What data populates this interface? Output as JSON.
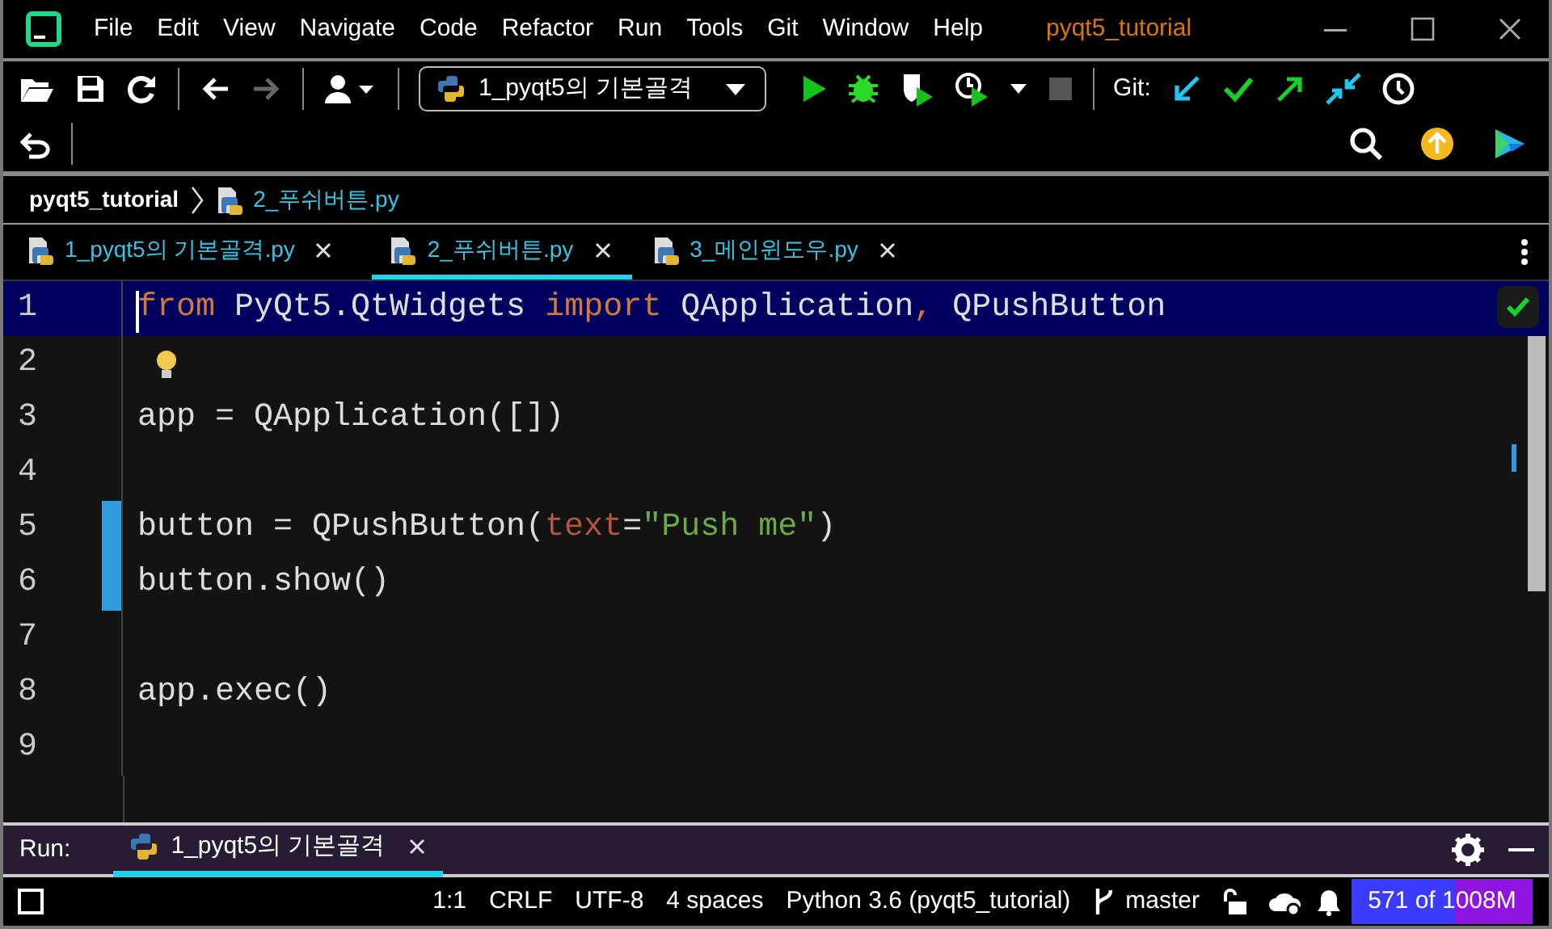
{
  "window": {
    "title": "pyqt5_tutorial"
  },
  "menu": [
    "File",
    "Edit",
    "View",
    "Navigate",
    "Code",
    "Refactor",
    "Run",
    "Tools",
    "Git",
    "Window",
    "Help"
  ],
  "toolbar": {
    "run_config": "1_pyqt5의 기본골격",
    "git_label": "Git:"
  },
  "breadcrumb": [
    "pyqt5_tutorial",
    "2_푸쉬버튼.py"
  ],
  "tabs": [
    {
      "label": "1_pyqt5의 기본골격.py",
      "selected": false
    },
    {
      "label": "2_푸쉬버튼.py",
      "selected": true
    },
    {
      "label": "3_메인윈도우.py",
      "selected": false
    }
  ],
  "editor": {
    "lines": [
      {
        "number": "1",
        "current": true,
        "changed": false,
        "bulb": false,
        "tokens": [
          {
            "kind": "keyword",
            "text": "from"
          },
          {
            "kind": "plain",
            "text": " PyQt5.QtWidgets "
          },
          {
            "kind": "keyword",
            "text": "import"
          },
          {
            "kind": "plain",
            "text": " QApplication"
          },
          {
            "kind": "keyword",
            "text": ","
          },
          {
            "kind": "plain",
            "text": " QPushButton"
          }
        ]
      },
      {
        "number": "2",
        "current": false,
        "changed": false,
        "bulb": true
      },
      {
        "number": "3",
        "current": false,
        "changed": false,
        "bulb": false,
        "tokens": [
          {
            "kind": "plain",
            "text": "app = QApplication([])"
          }
        ]
      },
      {
        "number": "4",
        "current": false,
        "changed": false,
        "bulb": false
      },
      {
        "number": "5",
        "current": false,
        "changed": true,
        "bulb": false,
        "tokens": [
          {
            "kind": "plain",
            "text": "button = QPushButton("
          },
          {
            "kind": "param",
            "text": "text"
          },
          {
            "kind": "plain",
            "text": "="
          },
          {
            "kind": "string",
            "text": "\"Push me\""
          },
          {
            "kind": "plain",
            "text": ")"
          }
        ]
      },
      {
        "number": "6",
        "current": false,
        "changed": true,
        "bulb": false,
        "tokens": [
          {
            "kind": "plain",
            "text": "button.show()"
          }
        ]
      },
      {
        "number": "7",
        "current": false,
        "changed": false,
        "bulb": false
      },
      {
        "number": "8",
        "current": false,
        "changed": false,
        "bulb": false,
        "tokens": [
          {
            "kind": "plain",
            "text": "app.exec()"
          }
        ]
      },
      {
        "number": "9",
        "current": false,
        "changed": false,
        "bulb": false
      }
    ]
  },
  "run_panel": {
    "label": "Run:",
    "tab": "1_pyqt5의 기본골격"
  },
  "status_bar": {
    "position": "1:1",
    "line_separator": "CRLF",
    "encoding": "UTF-8",
    "indent": "4 spaces",
    "interpreter": "Python 3.6 (pyqt5_tutorial)",
    "branch": "master",
    "memory": {
      "text": "571 of 1008M",
      "level": 0.57
    }
  }
}
